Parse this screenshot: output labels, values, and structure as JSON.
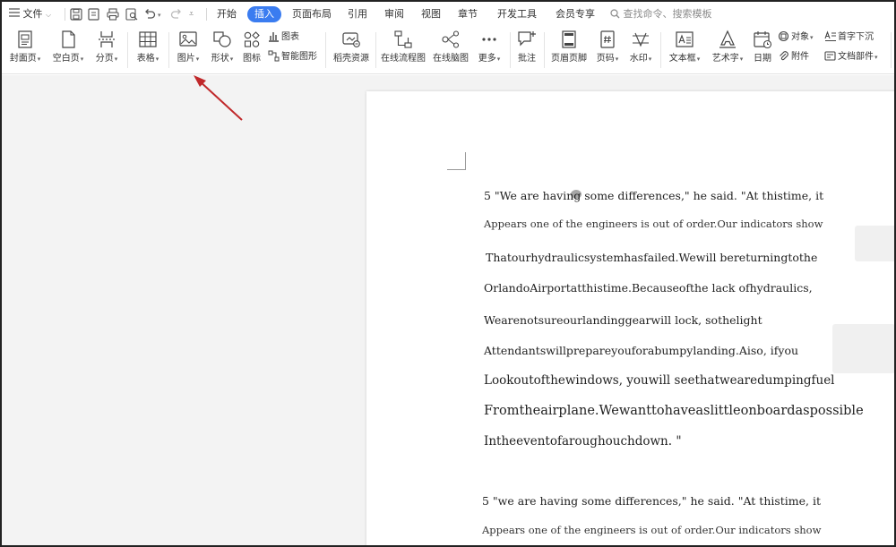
{
  "menu": {
    "file_label": "文件",
    "tabs": [
      "开始",
      "插入",
      "页面布局",
      "引用",
      "审阅",
      "视图",
      "章节",
      "开发工具",
      "会员专享"
    ],
    "active_tab": "插入",
    "search_placeholder": "查找命令、搜索模板"
  },
  "ribbon": {
    "cover_page": "封面页",
    "blank_page": "空白页",
    "page_break": "分页",
    "table": "表格",
    "picture": "图片",
    "shape": "形状",
    "icon": "图标",
    "chart": "图表",
    "smart_graphic": "智能图形",
    "docer_resources": "稻壳资源",
    "online_flowchart": "在线流程图",
    "online_mindmap": "在线脑图",
    "more": "更多",
    "comment": "批注",
    "header_footer": "页眉页脚",
    "page_number": "页码",
    "watermark": "水印",
    "text_box": "文本框",
    "word_art": "艺术字",
    "date": "日期",
    "object": "对象",
    "attachment": "附件",
    "drop_cap": "首字下沉",
    "doc_parts": "文档部件"
  },
  "document": {
    "lines": [
      "5 \"We are having some differences,\" he said. \"At thistime, it",
      "Appears one of the engineers is out of order.Our indicators show",
      "Thatourhydraulicsystemhasfailed.Wewill bereturningtothe",
      "OrlandoAirportatthistime.Becauseofthe lack ofhydraulics,",
      "Wearenotsureourlandinggearwill lock, sothelight",
      "Attendantswillprepareyouforabumpylanding.Aiso, ifyou",
      "Lookoutofthewindows, youwill seethatwearedumpingfuel",
      "Fromtheairplane.Wewanttohaveaslittleonboardaspossible",
      "Intheeventofaroughouchdown. \"",
      "5 \"we are having some differences,\" he said. \"At thistime, it",
      "Appears one of the engineers is out of order.Our indicators show"
    ]
  },
  "colors": {
    "accent": "#3a7cf0",
    "arrow": "#c0282a",
    "doc_background": "#f3f3f3"
  }
}
